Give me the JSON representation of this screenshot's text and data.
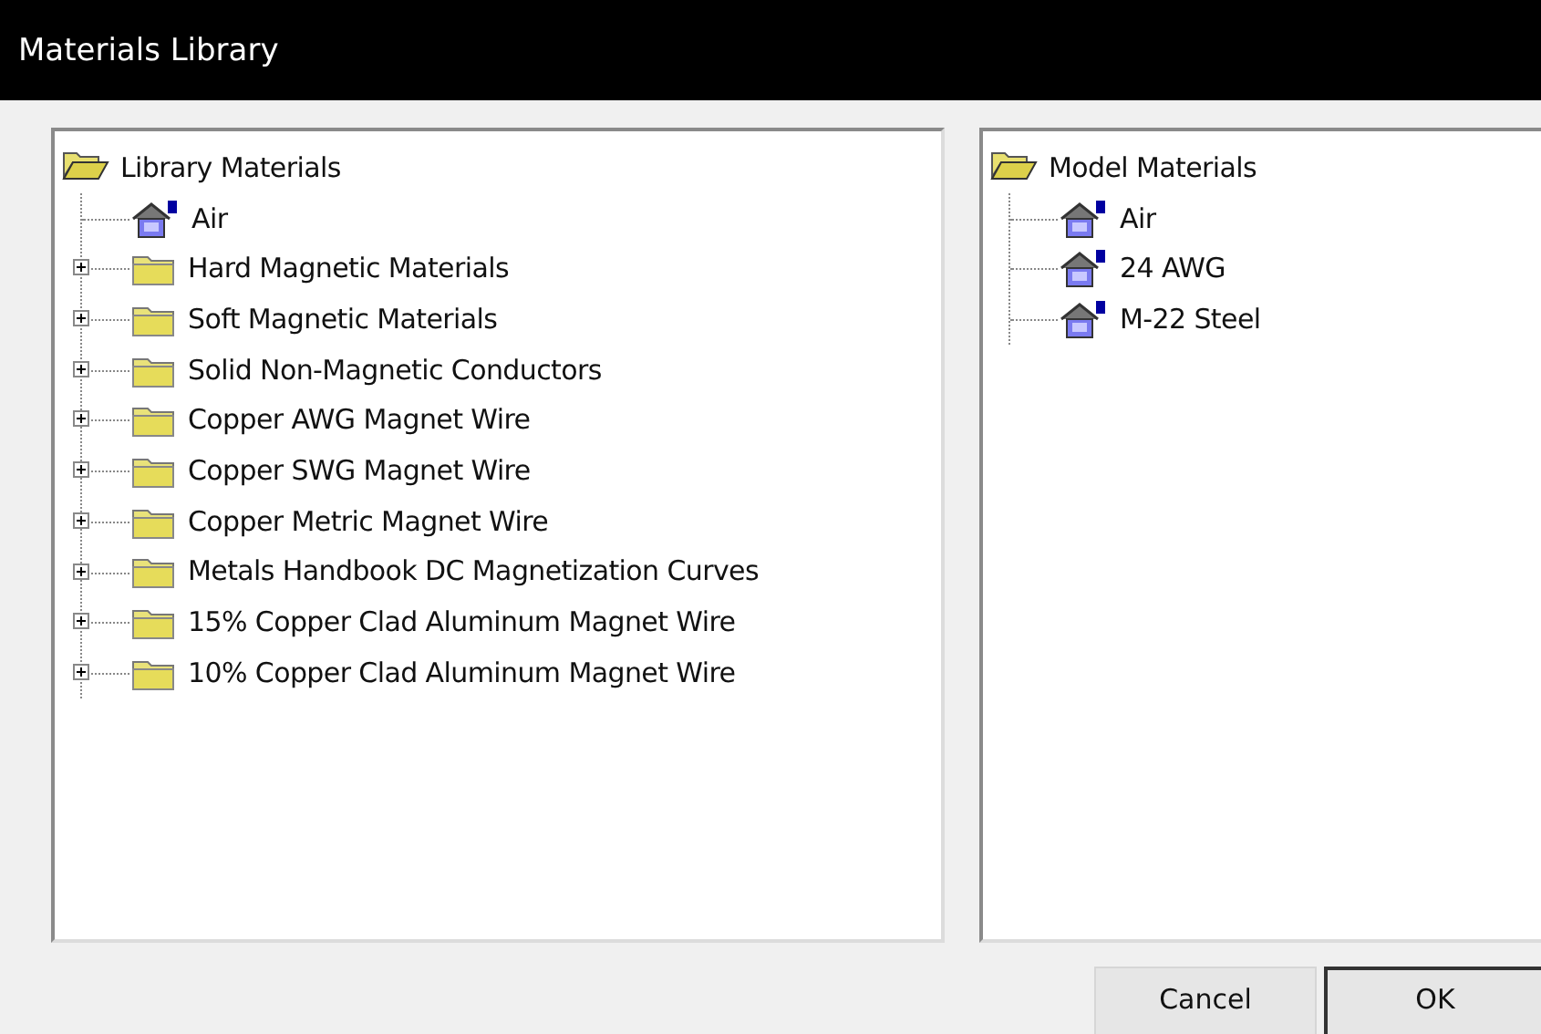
{
  "window": {
    "title": "Materials Library"
  },
  "library_tree": {
    "label": "Library Materials",
    "expanded": true,
    "children": [
      {
        "kind": "material",
        "label": "Air"
      },
      {
        "kind": "folder",
        "label": "Hard Magnetic Materials",
        "expanded": false
      },
      {
        "kind": "folder",
        "label": "Soft Magnetic Materials",
        "expanded": false
      },
      {
        "kind": "folder",
        "label": "Solid Non-Magnetic Conductors",
        "expanded": false
      },
      {
        "kind": "folder",
        "label": "Copper AWG Magnet Wire",
        "expanded": false
      },
      {
        "kind": "folder",
        "label": "Copper SWG Magnet Wire",
        "expanded": false
      },
      {
        "kind": "folder",
        "label": "Copper Metric Magnet Wire",
        "expanded": false
      },
      {
        "kind": "folder",
        "label": "Metals Handbook DC Magnetization Curves",
        "expanded": false
      },
      {
        "kind": "folder",
        "label": "15% Copper Clad Aluminum Magnet Wire",
        "expanded": false
      },
      {
        "kind": "folder",
        "label": "10% Copper Clad Aluminum Magnet Wire",
        "expanded": false
      }
    ]
  },
  "model_tree": {
    "label": "Model Materials",
    "expanded": true,
    "children": [
      {
        "kind": "material",
        "label": "Air"
      },
      {
        "kind": "material",
        "label": "24 AWG"
      },
      {
        "kind": "material",
        "label": "M-22 Steel"
      }
    ]
  },
  "buttons": [
    {
      "label": "Cancel",
      "default": false
    },
    {
      "label": "OK",
      "default": true
    }
  ]
}
